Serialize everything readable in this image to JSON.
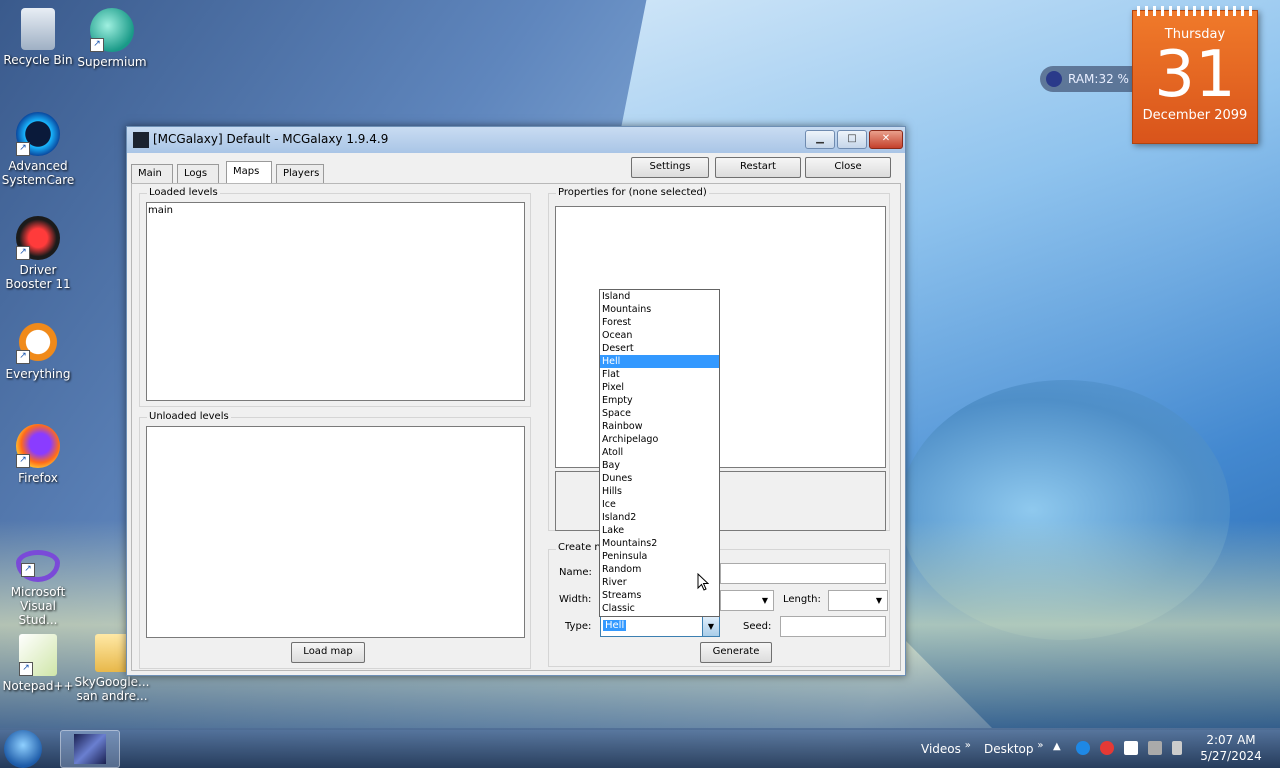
{
  "desktop": {
    "icons": [
      {
        "label": "Recycle Bin"
      },
      {
        "label": "Supermium"
      },
      {
        "label": "Advanced SystemCare"
      },
      {
        "label": "Driver Booster 11"
      },
      {
        "label": "Everything"
      },
      {
        "label": "Firefox"
      },
      {
        "label": "Microsoft Visual Stud..."
      },
      {
        "label": "Notepad++"
      },
      {
        "label": "SkyGoogle... san andre..."
      }
    ]
  },
  "widgets": {
    "calendar": {
      "weekday": "Thursday",
      "day": "31",
      "month_year": "December 2099"
    },
    "ram": {
      "label": "RAM:32 %"
    }
  },
  "window": {
    "title": "[MCGalaxy] Default - MCGalaxy 1.9.4.9",
    "tabs": [
      {
        "label": "Main"
      },
      {
        "label": "Logs"
      },
      {
        "label": "Maps",
        "active": true
      },
      {
        "label": "Players"
      }
    ],
    "toolbar": {
      "settings": "Settings",
      "restart": "Restart",
      "close": "Close"
    },
    "loaded_levels": {
      "title": "Loaded levels",
      "items": [
        "main"
      ]
    },
    "unloaded_levels": {
      "title": "Unloaded levels",
      "items": []
    },
    "load_map_button": "Load map",
    "properties": {
      "title": "Properties for (none selected)"
    },
    "create": {
      "title": "Create n",
      "name_label": "Name:",
      "width_label": "Width:",
      "length_label": "Length:",
      "type_label": "Type:",
      "type_value": "Hell",
      "seed_label": "Seed:",
      "generate_button": "Generate"
    },
    "type_dropdown": {
      "selected": "Hell",
      "options": [
        "Island",
        "Mountains",
        "Forest",
        "Ocean",
        "Desert",
        "Hell",
        "Flat",
        "Pixel",
        "Empty",
        "Space",
        "Rainbow",
        "Archipelago",
        "Atoll",
        "Bay",
        "Dunes",
        "Hills",
        "Ice",
        "Island2",
        "Lake",
        "Mountains2",
        "Peninsula",
        "Random",
        "River",
        "Streams",
        "Classic"
      ]
    }
  },
  "taskbar": {
    "toolbars": [
      "Videos",
      "Desktop"
    ],
    "clock": {
      "time": "2:07 AM",
      "date": "5/27/2024"
    }
  },
  "colors": {
    "accent": "#3399ff",
    "calendar": "#e8641f",
    "close_button": "#c4402b"
  }
}
